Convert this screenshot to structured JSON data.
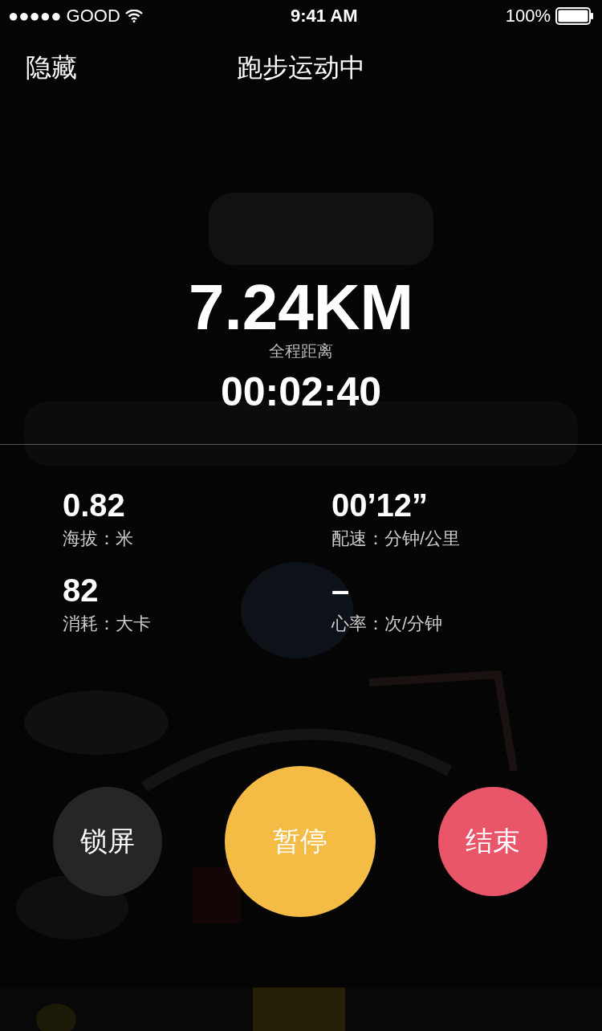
{
  "status_bar": {
    "signal": "●●●●● GOOD",
    "time": "9:41 AM",
    "battery": "100%"
  },
  "nav": {
    "left": "隐藏",
    "title": "跑步运动中"
  },
  "distance": {
    "value": "7.24KM",
    "label": "全程距离"
  },
  "duration": "00:02:40",
  "stats": [
    {
      "value": "0.82",
      "label": "海拔：米"
    },
    {
      "value": "00’12”",
      "label": "配速：分钟/公里"
    },
    {
      "value": "82",
      "label": "消耗：大卡"
    },
    {
      "value": "–",
      "label": "心率：次/分钟"
    }
  ],
  "buttons": [
    {
      "kind": "lock",
      "label": "锁屏"
    },
    {
      "kind": "pause",
      "label": "暂停"
    },
    {
      "kind": "end",
      "label": "结束"
    }
  ]
}
